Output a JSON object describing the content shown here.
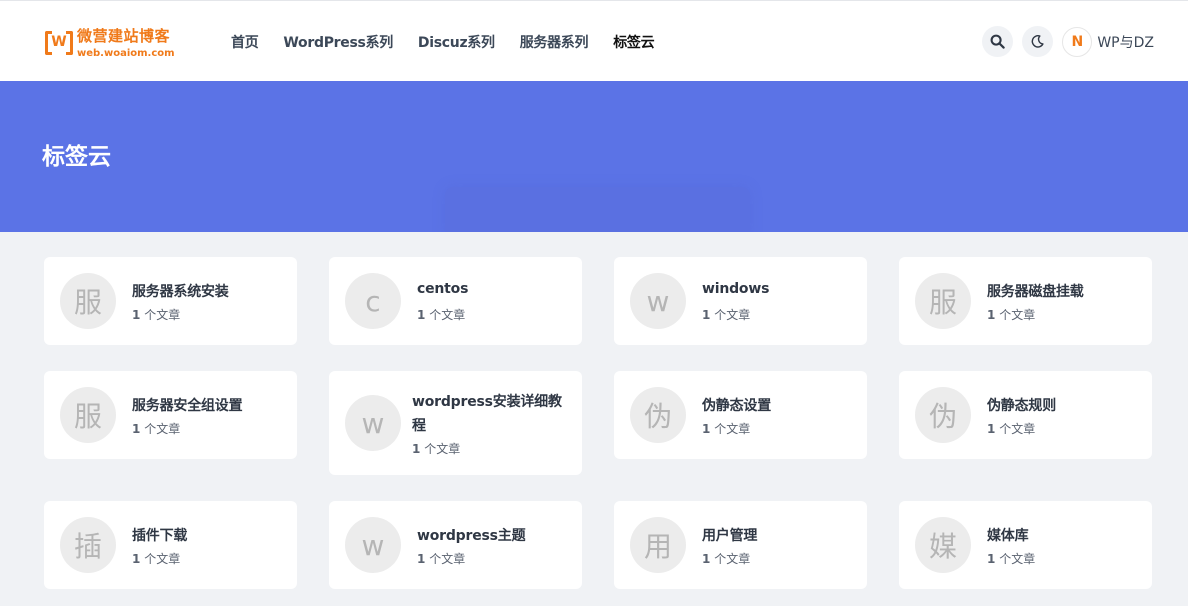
{
  "header": {
    "logo": {
      "title": "微营建站博客",
      "domain": "web.woaiom.com",
      "mark": "W"
    },
    "nav": [
      {
        "label": "首页"
      },
      {
        "label": "WordPress系列"
      },
      {
        "label": "Discuz系列"
      },
      {
        "label": "服务器系列"
      },
      {
        "label": "标签云"
      }
    ],
    "site_mark": "N",
    "site_name": "WP与DZ"
  },
  "banner": {
    "title": "标签云"
  },
  "tags": [
    {
      "initial": "服",
      "name": "服务器系统安装",
      "count": "1",
      "unit": "个文章"
    },
    {
      "initial": "c",
      "name": "centos",
      "count": "1",
      "unit": "个文章"
    },
    {
      "initial": "w",
      "name": "windows",
      "count": "1",
      "unit": "个文章"
    },
    {
      "initial": "服",
      "name": "服务器磁盘挂载",
      "count": "1",
      "unit": "个文章"
    },
    {
      "initial": "服",
      "name": "服务器安全组设置",
      "count": "1",
      "unit": "个文章"
    },
    {
      "initial": "w",
      "name": "wordpress安装详细教程",
      "name_line1": "wordpress安装详细教",
      "name_line2": "程",
      "count": "1",
      "unit": "个文章"
    },
    {
      "initial": "伪",
      "name": "伪静态设置",
      "count": "1",
      "unit": "个文章"
    },
    {
      "initial": "伪",
      "name": "伪静态规则",
      "count": "1",
      "unit": "个文章"
    },
    {
      "initial": "插",
      "name": "插件下载",
      "count": "1",
      "unit": "个文章"
    },
    {
      "initial": "w",
      "name": "wordpress主题",
      "count": "1",
      "unit": "个文章"
    },
    {
      "initial": "用",
      "name": "用户管理",
      "count": "1",
      "unit": "个文章"
    },
    {
      "initial": "媒",
      "name": "媒体库",
      "count": "1",
      "unit": "个文章"
    }
  ],
  "colors": {
    "brand": "#f07a1a",
    "banner": "#5b73e6",
    "page_bg": "#f0f2f5"
  }
}
